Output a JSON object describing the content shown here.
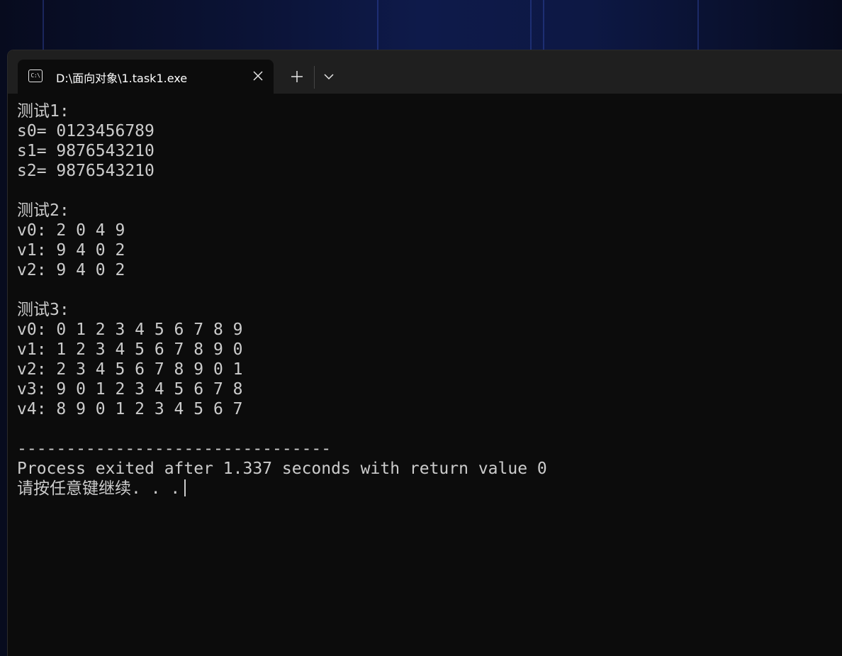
{
  "window": {
    "tab_title": "D:\\面向对象\\1.task1.exe",
    "tab_icon_text": "C:\\",
    "icons": {
      "tab": "console-icon",
      "close": "close-icon",
      "new_tab": "plus-icon",
      "dropdown": "chevron-down-icon"
    }
  },
  "console": {
    "lines": [
      "测试1:",
      "s0= 0123456789",
      "s1= 9876543210",
      "s2= 9876543210",
      "",
      "测试2:",
      "v0: 2 0 4 9",
      "v1: 9 4 0 2",
      "v2: 9 4 0 2",
      "",
      "测试3:",
      "v0: 0 1 2 3 4 5 6 7 8 9",
      "v1: 1 2 3 4 5 6 7 8 9 0",
      "v2: 2 3 4 5 6 7 8 9 0 1",
      "v3: 9 0 1 2 3 4 5 6 7 8",
      "v4: 8 9 0 1 2 3 4 5 6 7",
      "",
      "--------------------------------",
      "Process exited after 1.337 seconds with return value 0",
      "请按任意键继续. . ."
    ]
  },
  "colors": {
    "console_bg": "#0c0c0c",
    "console_text": "#cccccc",
    "titlebar_bg": "#1f1f1f"
  }
}
